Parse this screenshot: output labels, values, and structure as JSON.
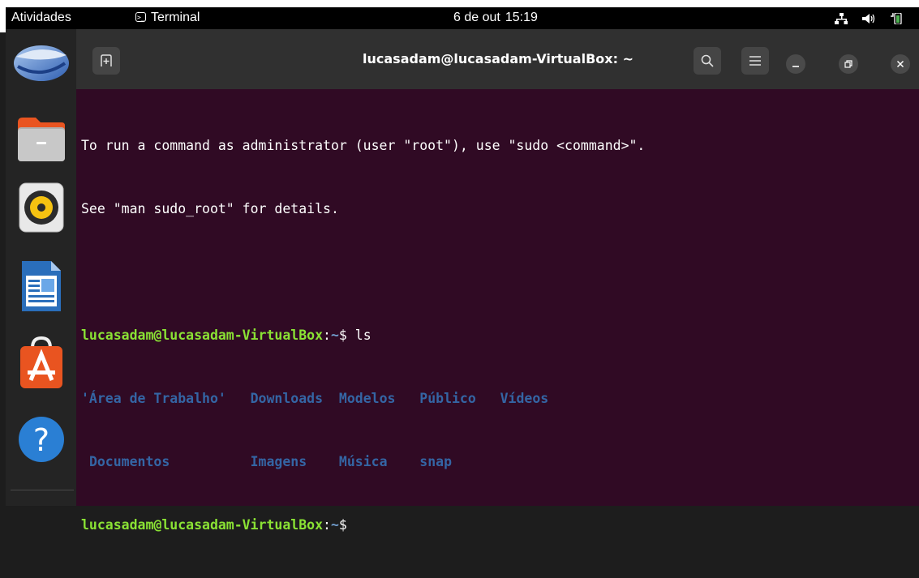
{
  "topbar": {
    "activities": "Atividades",
    "app_menu_label": "Terminal",
    "clock_date": "6 de out",
    "clock_time": "15:19",
    "tray_icons": [
      "network-icon",
      "volume-icon",
      "battery-icon"
    ]
  },
  "dock": {
    "items": [
      {
        "name": "thunderbird",
        "icon": "mail-icon"
      },
      {
        "name": "files",
        "icon": "folder-icon"
      },
      {
        "name": "rhythmbox",
        "icon": "speaker-icon"
      },
      {
        "name": "libreoffice-writer",
        "icon": "writer-icon"
      },
      {
        "name": "ubuntu-software",
        "icon": "software-store-icon"
      },
      {
        "name": "help",
        "icon": "help-icon"
      }
    ]
  },
  "window": {
    "title": "lucasadam@lucasadam-VirtualBox: ~"
  },
  "terminal": {
    "notice_line1": "To run a command as administrator (user \"root\"), use \"sudo <command>\".",
    "notice_line2": "See \"man sudo_root\" for details.",
    "prompt_user": "lucasadam@lucasadam-VirtualBox",
    "prompt_sep": ":",
    "prompt_path": "~",
    "prompt_symbol": "$ ",
    "command": "ls",
    "ls_row1": [
      "'Área de Trabalho'",
      "Downloads",
      "Modelos",
      "Público",
      "Vídeos"
    ],
    "ls_row2": [
      "Documentos",
      "Imagens",
      "Música",
      "snap"
    ]
  },
  "colors": {
    "terminal_bg": "#300a24",
    "prompt_green": "#8ae234",
    "path_blue": "#729fcf",
    "dir_blue": "#3465a4",
    "headerbar": "#303030",
    "dock": "#242424"
  }
}
